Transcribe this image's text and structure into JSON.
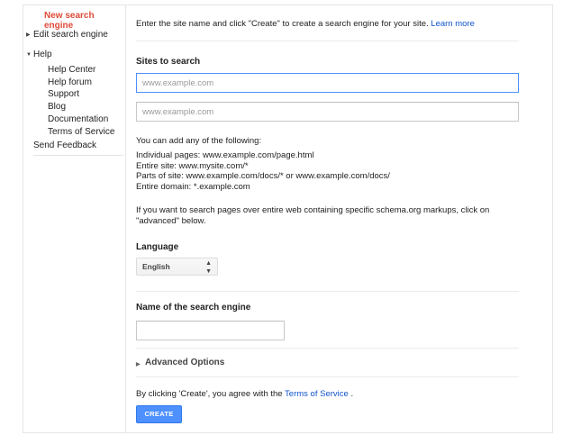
{
  "sidebar": {
    "new_search_engine": "New search engine",
    "edit_search_engine": "Edit search engine",
    "help": "Help",
    "help_items": [
      "Help Center",
      "Help forum",
      "Support",
      "Blog",
      "Documentation",
      "Terms of Service"
    ],
    "send_feedback": "Send Feedback"
  },
  "main": {
    "intro_text": "Enter the site name and click \"Create\" to create a search engine for your site.",
    "learn_more": "Learn more",
    "sites_label": "Sites to search",
    "site_inputs": [
      {
        "placeholder": "www.example.com",
        "value": ""
      },
      {
        "placeholder": "www.example.com",
        "value": ""
      }
    ],
    "add_heading": "You can add any of the following:",
    "add_examples": [
      "Individual pages: www.example.com/page.html",
      "Entire site: www.mysite.com/*",
      "Parts of site: www.example.com/docs/* or www.example.com/docs/",
      "Entire domain: *.example.com"
    ],
    "schema_note_line1": "If you want to search pages over entire web containing specific schema.org markups, click on",
    "schema_note_line2": "\"advanced\" below.",
    "language_label": "Language",
    "language_value": "English",
    "name_label": "Name of the search engine",
    "name_value": "",
    "advanced_label": "Advanced Options",
    "agree_prefix": "By clicking 'Create', you agree with the",
    "terms_link": "Terms of Service",
    "agree_suffix": ".",
    "create_button": "CREATE"
  },
  "colors": {
    "accent_red": "#dd4b39",
    "link_blue": "#1155cc",
    "button_blue": "#4d90fe",
    "focus_blue": "#4d90fe"
  }
}
